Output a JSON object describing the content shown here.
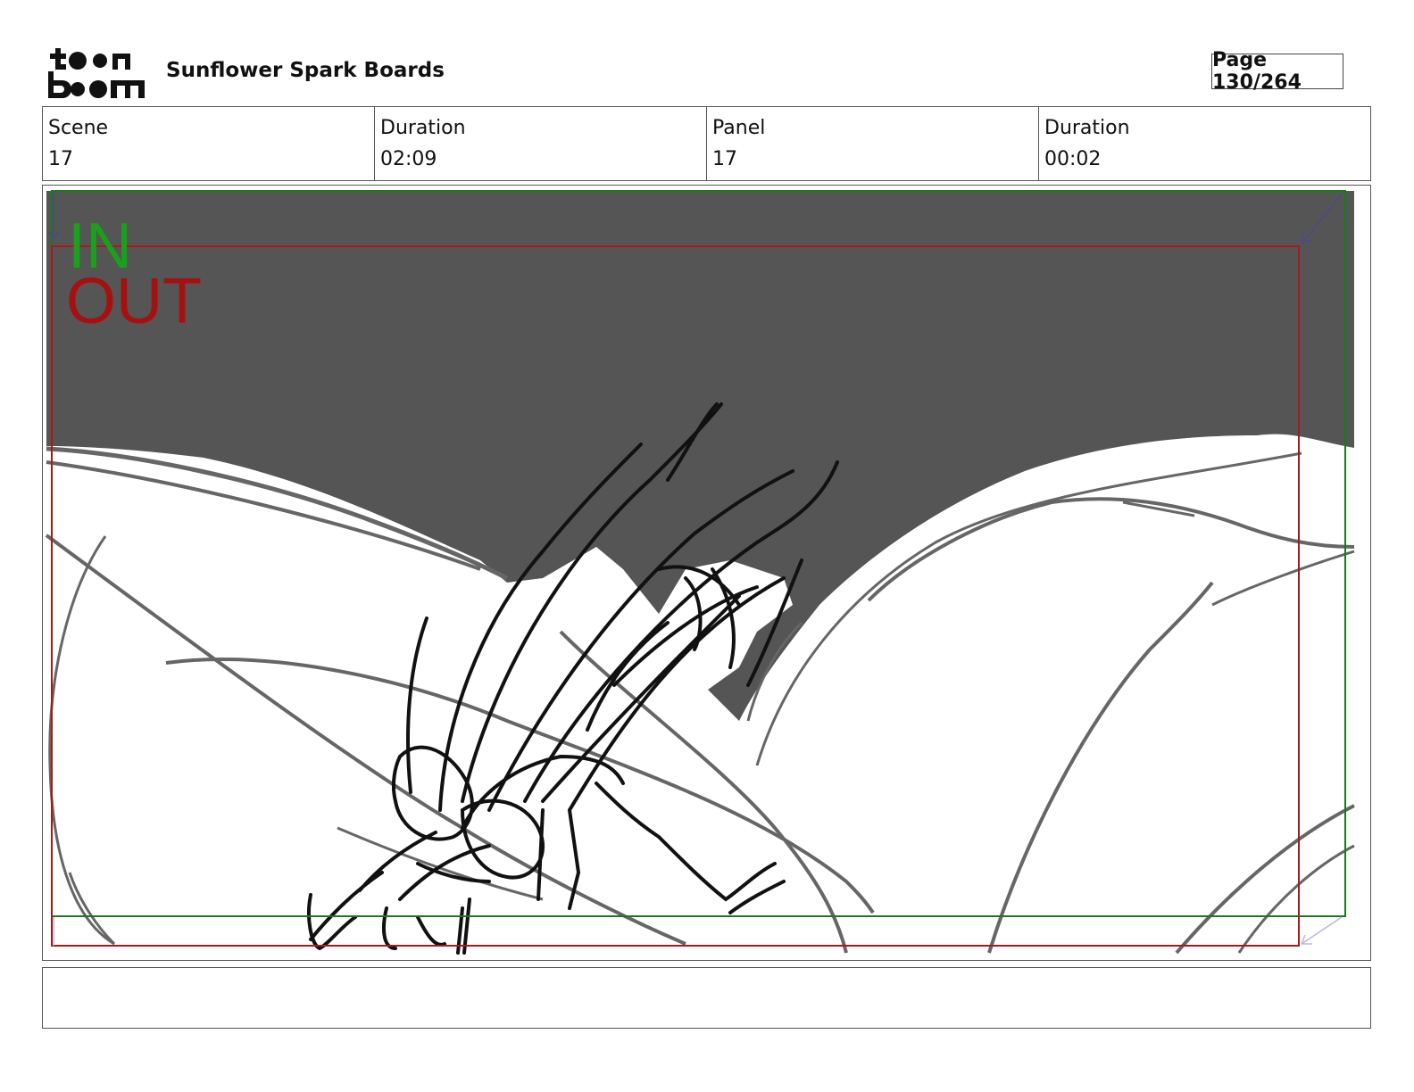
{
  "header": {
    "logo_text": "toon boom",
    "project_title": "Sunflower Spark Boards",
    "page_label": "Page 130/264"
  },
  "info": {
    "scene_label": "Scene",
    "scene_value": "17",
    "scene_duration_label": "Duration",
    "scene_duration_value": "02:09",
    "panel_label": "Panel",
    "panel_value": "17",
    "panel_duration_label": "Duration",
    "panel_duration_value": "00:02"
  },
  "panel": {
    "in_label": "IN",
    "out_label": "OUT",
    "in_color": "#1aa01a",
    "out_color": "#a80f0f",
    "sky_color": "#555555"
  },
  "notes": {
    "text": ""
  }
}
